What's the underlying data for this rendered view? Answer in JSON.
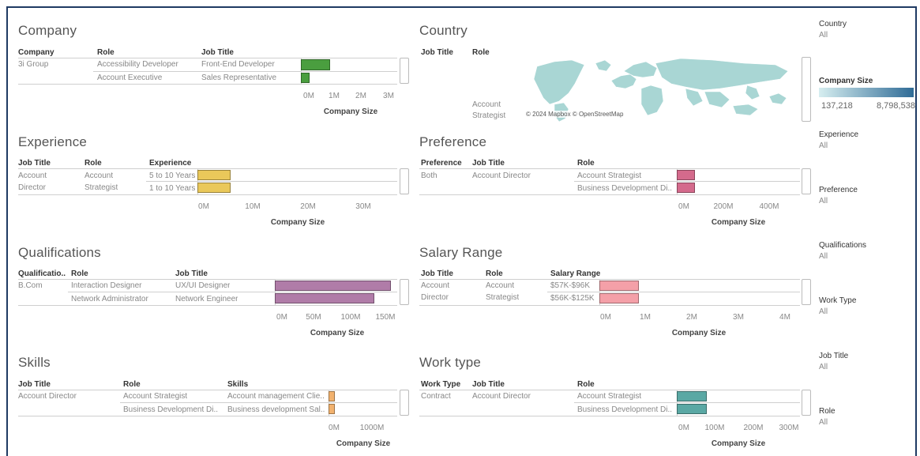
{
  "company": {
    "title": "Company",
    "headers": [
      "Company",
      "Role",
      "Job Title"
    ],
    "company_name": "3i Group",
    "rows": [
      {
        "role": "Accessibility Developer",
        "job": "Front-End Developer",
        "value": 1.0
      },
      {
        "role": "Account Executive",
        "job": "Sales Representative",
        "value": 0.3
      }
    ],
    "ticks": [
      "0M",
      "1M",
      "2M",
      "3M"
    ],
    "axis_title": "Company Size",
    "color": "#4a9e3f"
  },
  "country": {
    "title": "Country",
    "headers": [
      "Job Title",
      "Role"
    ],
    "role_lines": [
      "Account",
      "Strategist"
    ],
    "attribution": "© 2024 Mapbox © OpenStreetMap",
    "map_color": "#a9d6d4"
  },
  "experience": {
    "title": "Experience",
    "headers": [
      "Job Title",
      "Role",
      "Experience"
    ],
    "job_lines": [
      "Account",
      "Director"
    ],
    "role_lines": [
      "Account",
      "Strategist"
    ],
    "rows": [
      {
        "label": "5 to 10 Years",
        "value": 6.0
      },
      {
        "label": "1 to 10 Years",
        "value": 6.0
      }
    ],
    "ticks": [
      "0M",
      "10M",
      "20M",
      "30M"
    ],
    "axis_title": "Company Size",
    "color": "#eac85a"
  },
  "preference": {
    "title": "Preference",
    "headers": [
      "Preference",
      "Job Title",
      "Role"
    ],
    "preference": "Both",
    "job": "Account Director",
    "rows": [
      {
        "role": "Account Strategist",
        "value": 80
      },
      {
        "role": "Business Development Di..",
        "value": 80
      }
    ],
    "ticks": [
      "0M",
      "200M",
      "400M"
    ],
    "axis_title": "Company Size",
    "color": "#d46a8c"
  },
  "qualifications": {
    "title": "Qualifications",
    "headers": [
      "Qualificatio..",
      "Role",
      "Job Title"
    ],
    "qualification": "B.Com",
    "rows": [
      {
        "role": "Interaction Designer",
        "job": "UX/UI Designer",
        "value": 158
      },
      {
        "role": "Network Administrator",
        "job": "Network Engineer",
        "value": 135
      }
    ],
    "ticks": [
      "0M",
      "50M",
      "100M",
      "150M"
    ],
    "axis_title": "Company Size",
    "color": "#b07ca8"
  },
  "salary": {
    "title": "Salary Range",
    "headers": [
      "Job Title",
      "Role",
      "Salary Range"
    ],
    "job_lines": [
      "Account",
      "Director"
    ],
    "role_lines": [
      "Account",
      "Strategist"
    ],
    "rows": [
      {
        "label": "$57K-$96K",
        "value": 0.85
      },
      {
        "label": "$56K-$125K",
        "value": 0.85
      }
    ],
    "ticks": [
      "0M",
      "1M",
      "2M",
      "3M",
      "4M"
    ],
    "axis_title": "Company Size",
    "color": "#f4a0a8"
  },
  "skills": {
    "title": "Skills",
    "headers": [
      "Job Title",
      "Role",
      "Skills"
    ],
    "job": "Account Director",
    "rows": [
      {
        "role": "Account Strategist",
        "skill": "Account management Clie..",
        "value": 150
      },
      {
        "role": "Business Development Di..",
        "skill": "Business development Sal..",
        "value": 150
      }
    ],
    "ticks": [
      "0M",
      "1000M"
    ],
    "axis_title": "Company Size",
    "color": "#f2b26e"
  },
  "worktype": {
    "title": "Work type",
    "headers": [
      "Work Type",
      "Job Title",
      "Role"
    ],
    "work_type": "Contract",
    "job": "Account Director",
    "rows": [
      {
        "role": "Account Strategist",
        "value": 80
      },
      {
        "role": "Business Development Di..",
        "value": 80
      }
    ],
    "ticks": [
      "0M",
      "100M",
      "200M",
      "300M"
    ],
    "axis_title": "Company Size",
    "color": "#5aa8a4"
  },
  "filters": {
    "country_title": "Country",
    "country_value": "All",
    "size_title": "Company Size",
    "size_min": "137,218",
    "size_max": "8,798,538",
    "experience_title": "Experience",
    "experience_value": "All",
    "preference_title": "Preference",
    "preference_value": "All",
    "qualifications_title": "Qualifications",
    "qualifications_value": "All",
    "worktype_title": "Work Type",
    "worktype_value": "All",
    "jobtitle_title": "Job Title",
    "jobtitle_value": "All",
    "role_title": "Role",
    "role_value": "All"
  }
}
